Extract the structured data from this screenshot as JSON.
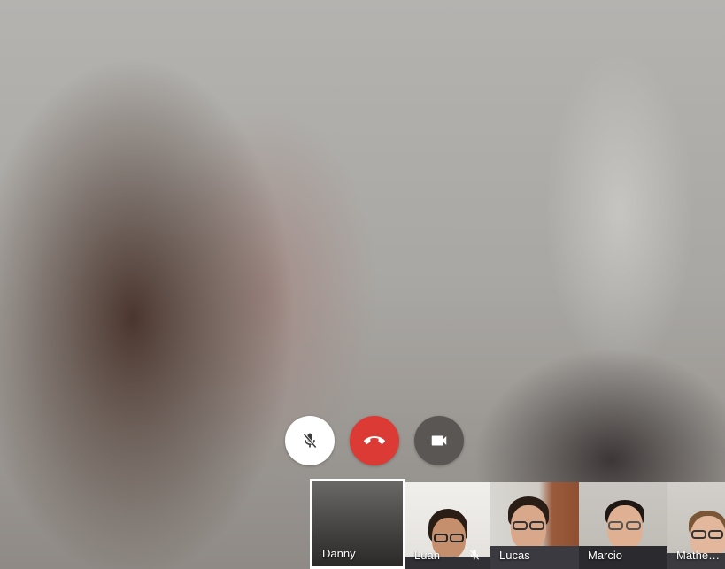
{
  "call": {
    "controls": {
      "mic_icon": "mic-off-icon",
      "hangup_icon": "phone-hangup-icon",
      "camera_icon": "videocam-icon",
      "colors": {
        "mic_bg": "#ffffff",
        "hangup_bg": "#db3a35",
        "camera_bg": "#5a5654"
      }
    },
    "participants": [
      {
        "name": "Danny",
        "self": true,
        "muted": false
      },
      {
        "name": "Luan",
        "self": false,
        "muted": true
      },
      {
        "name": "Lucas",
        "self": false,
        "muted": false
      },
      {
        "name": "Marcio",
        "self": false,
        "muted": false
      },
      {
        "name": "Mathe…",
        "self": false,
        "muted": false
      }
    ]
  }
}
